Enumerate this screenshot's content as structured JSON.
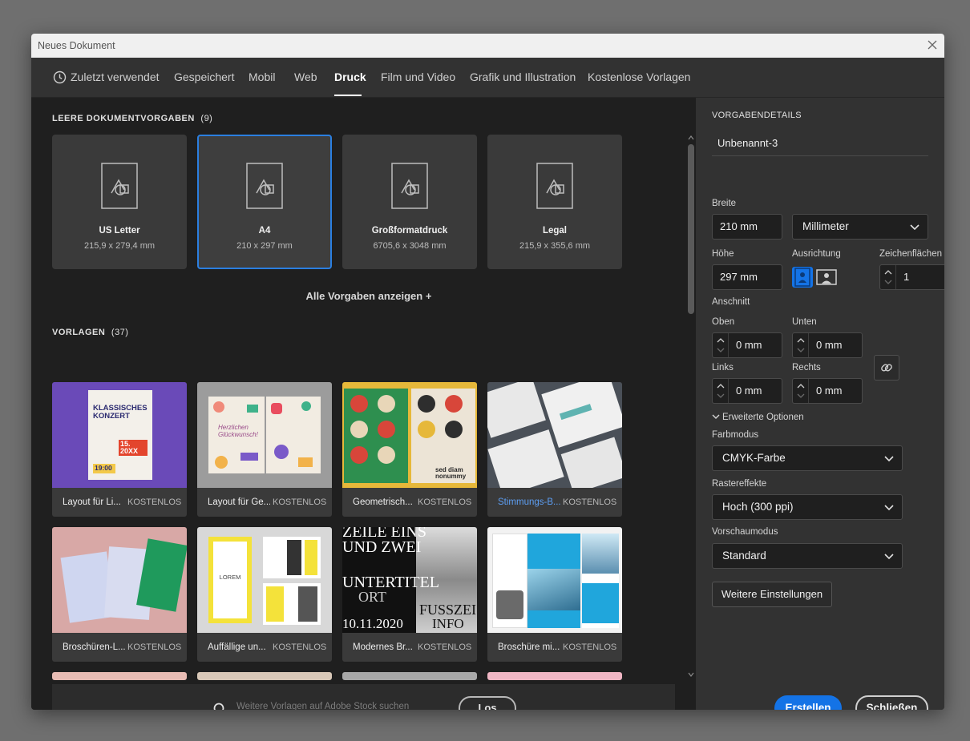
{
  "window": {
    "title": "Neues Dokument"
  },
  "tabs": [
    {
      "label": "Zuletzt verwendet",
      "icon": "clock-icon"
    },
    {
      "label": "Gespeichert"
    },
    {
      "label": "Mobil"
    },
    {
      "label": "Web"
    },
    {
      "label": "Druck",
      "active": true
    },
    {
      "label": "Film und Video"
    },
    {
      "label": "Grafik und Illustration"
    },
    {
      "label": "Kostenlose Vorlagen"
    }
  ],
  "presets": {
    "heading": "LEERE DOKUMENTVORGABEN",
    "count": "(9)",
    "items": [
      {
        "name": "US Letter",
        "size": "215,9 x 279,4 mm"
      },
      {
        "name": "A4",
        "size": "210 x 297 mm",
        "selected": true
      },
      {
        "name": "Großformatdruck",
        "size": "6705,6 x 3048 mm"
      },
      {
        "name": "Legal",
        "size": "215,9 x 355,6 mm"
      }
    ],
    "show_all": "Alle Vorgaben anzeigen +"
  },
  "templates": {
    "heading": "VORLAGEN",
    "count": "(37)",
    "items": [
      {
        "name": "Layout für Li...",
        "badge": "KOSTENLOS"
      },
      {
        "name": "Layout für Ge...",
        "badge": "KOSTENLOS"
      },
      {
        "name": "Geometrisch...",
        "badge": "KOSTENLOS"
      },
      {
        "name": "Stimmungs-B...",
        "badge": "KOSTENLOS",
        "highlighted": true
      },
      {
        "name": "Broschüren-L...",
        "badge": "KOSTENLOS"
      },
      {
        "name": "Auffällige un...",
        "badge": "KOSTENLOS"
      },
      {
        "name": "Modernes Br...",
        "badge": "KOSTENLOS"
      },
      {
        "name": "Broschüre mi...",
        "badge": "KOSTENLOS"
      }
    ],
    "thumb_text": {
      "concert_title": "KLASSISCHES KONZERT",
      "concert_date": "20XX",
      "concert_day": "15.",
      "concert_time": "19:00",
      "greeting": "Herzlichen Glückwunsch!",
      "sed": "sed diam nonummy",
      "zeile_a": "ZEILE EINS",
      "zeile_b": "UND ZWEI",
      "untertitel": "UNTERTITEL",
      "ort": "ORT",
      "date2": "10.11.2020",
      "fussz": "FUSSZEI",
      "info": "INFO",
      "lorem": "LOREM"
    }
  },
  "search": {
    "placeholder": "Weitere Vorlagen auf Adobe Stock suchen",
    "button": "Los"
  },
  "details": {
    "heading": "VORGABENDETAILS",
    "name": "Unbenannt-3",
    "width_label": "Breite",
    "width": "210 mm",
    "unit": "Millimeter",
    "height_label": "Höhe",
    "height": "297 mm",
    "orientation_label": "Ausrichtung",
    "artboards_label": "Zeichenflächen",
    "artboards": "1",
    "bleed_label": "Anschnitt",
    "top_label": "Oben",
    "top": "0 mm",
    "bottom_label": "Unten",
    "bottom": "0 mm",
    "left_label": "Links",
    "left": "0 mm",
    "right_label": "Rechts",
    "right": "0 mm",
    "advanced": "Erweiterte Optionen",
    "color_mode_label": "Farbmodus",
    "color_mode": "CMYK-Farbe",
    "raster_label": "Rastereffekte",
    "raster": "Hoch (300 ppi)",
    "preview_label": "Vorschaumodus",
    "preview": "Standard",
    "more_settings": "Weitere Einstellungen",
    "create": "Erstellen",
    "close": "Schließen"
  },
  "colors": {
    "accent": "#1473e6",
    "selection": "#2b7fe0",
    "link": "#5d9ef2"
  }
}
